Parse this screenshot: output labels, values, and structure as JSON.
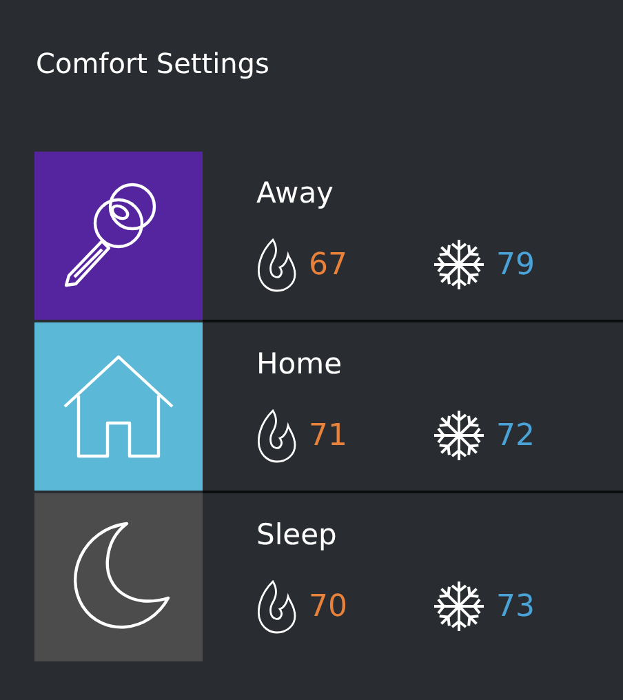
{
  "title": "Comfort Settings",
  "modes": [
    {
      "name": "Away",
      "kind": "key",
      "color": "#55249f",
      "heat": "67",
      "cool": "79"
    },
    {
      "name": "Home",
      "kind": "house",
      "color": "#5bb8d6",
      "heat": "71",
      "cool": "72"
    },
    {
      "name": "Sleep",
      "kind": "moon",
      "color": "#4c4c4c",
      "heat": "70",
      "cool": "73"
    }
  ]
}
